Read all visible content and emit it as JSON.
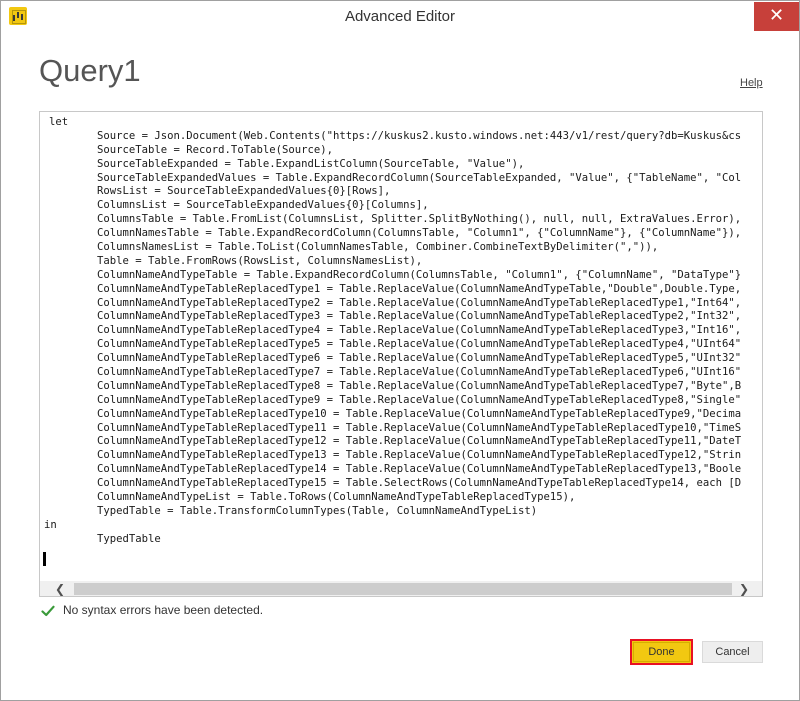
{
  "window": {
    "title": "Advanced Editor",
    "close_glyph": "✕"
  },
  "header": {
    "query_name": "Query1",
    "help_label": "Help"
  },
  "editor": {
    "lines": [
      {
        "indent": 0,
        "text": "let"
      },
      {
        "indent": 1,
        "text": "Source = Json.Document(Web.Contents(\"https://kuskus2.kusto.windows.net:443/v1/rest/query?db=Kuskus&cs"
      },
      {
        "indent": 1,
        "text": "SourceTable = Record.ToTable(Source),"
      },
      {
        "indent": 1,
        "text": "SourceTableExpanded = Table.ExpandListColumn(SourceTable, \"Value\"),"
      },
      {
        "indent": 1,
        "text": "SourceTableExpandedValues = Table.ExpandRecordColumn(SourceTableExpanded, \"Value\", {\"TableName\", \"Col"
      },
      {
        "indent": 1,
        "text": "RowsList = SourceTableExpandedValues{0}[Rows],"
      },
      {
        "indent": 1,
        "text": "ColumnsList = SourceTableExpandedValues{0}[Columns],"
      },
      {
        "indent": 1,
        "text": "ColumnsTable = Table.FromList(ColumnsList, Splitter.SplitByNothing(), null, null, ExtraValues.Error),"
      },
      {
        "indent": 1,
        "text": "ColumnNamesTable = Table.ExpandRecordColumn(ColumnsTable, \"Column1\", {\"ColumnName\"}, {\"ColumnName\"}),"
      },
      {
        "indent": 1,
        "text": "ColumnsNamesList = Table.ToList(ColumnNamesTable, Combiner.CombineTextByDelimiter(\",\")),"
      },
      {
        "indent": 1,
        "text": "Table = Table.FromRows(RowsList, ColumnsNamesList),"
      },
      {
        "indent": 1,
        "text": "ColumnNameAndTypeTable = Table.ExpandRecordColumn(ColumnsTable, \"Column1\", {\"ColumnName\", \"DataType\"}"
      },
      {
        "indent": 1,
        "text": "ColumnNameAndTypeTableReplacedType1 = Table.ReplaceValue(ColumnNameAndTypeTable,\"Double\",Double.Type,"
      },
      {
        "indent": 1,
        "text": "ColumnNameAndTypeTableReplacedType2 = Table.ReplaceValue(ColumnNameAndTypeTableReplacedType1,\"Int64\","
      },
      {
        "indent": 1,
        "text": "ColumnNameAndTypeTableReplacedType3 = Table.ReplaceValue(ColumnNameAndTypeTableReplacedType2,\"Int32\","
      },
      {
        "indent": 1,
        "text": "ColumnNameAndTypeTableReplacedType4 = Table.ReplaceValue(ColumnNameAndTypeTableReplacedType3,\"Int16\","
      },
      {
        "indent": 1,
        "text": "ColumnNameAndTypeTableReplacedType5 = Table.ReplaceValue(ColumnNameAndTypeTableReplacedType4,\"UInt64\""
      },
      {
        "indent": 1,
        "text": "ColumnNameAndTypeTableReplacedType6 = Table.ReplaceValue(ColumnNameAndTypeTableReplacedType5,\"UInt32\""
      },
      {
        "indent": 1,
        "text": "ColumnNameAndTypeTableReplacedType7 = Table.ReplaceValue(ColumnNameAndTypeTableReplacedType6,\"UInt16\""
      },
      {
        "indent": 1,
        "text": "ColumnNameAndTypeTableReplacedType8 = Table.ReplaceValue(ColumnNameAndTypeTableReplacedType7,\"Byte\",B"
      },
      {
        "indent": 1,
        "text": "ColumnNameAndTypeTableReplacedType9 = Table.ReplaceValue(ColumnNameAndTypeTableReplacedType8,\"Single\""
      },
      {
        "indent": 1,
        "text": "ColumnNameAndTypeTableReplacedType10 = Table.ReplaceValue(ColumnNameAndTypeTableReplacedType9,\"Decima"
      },
      {
        "indent": 1,
        "text": "ColumnNameAndTypeTableReplacedType11 = Table.ReplaceValue(ColumnNameAndTypeTableReplacedType10,\"TimeS"
      },
      {
        "indent": 1,
        "text": "ColumnNameAndTypeTableReplacedType12 = Table.ReplaceValue(ColumnNameAndTypeTableReplacedType11,\"DateT"
      },
      {
        "indent": 1,
        "text": "ColumnNameAndTypeTableReplacedType13 = Table.ReplaceValue(ColumnNameAndTypeTableReplacedType12,\"Strin"
      },
      {
        "indent": 1,
        "text": "ColumnNameAndTypeTableReplacedType14 = Table.ReplaceValue(ColumnNameAndTypeTableReplacedType13,\"Boole"
      },
      {
        "indent": 1,
        "text": "ColumnNameAndTypeTableReplacedType15 = Table.SelectRows(ColumnNameAndTypeTableReplacedType14, each [D"
      },
      {
        "indent": 1,
        "text": "ColumnNameAndTypeList = Table.ToRows(ColumnNameAndTypeTableReplacedType15),"
      },
      {
        "indent": 1,
        "text": "TypedTable = Table.TransformColumnTypes(Table, ColumnNameAndTypeList)"
      },
      {
        "indent": -1,
        "text": "in"
      },
      {
        "indent": 1,
        "text": "TypedTable"
      }
    ],
    "scroll_left_glyph": "❮",
    "scroll_right_glyph": "❯"
  },
  "status": {
    "icon": "check-icon",
    "message": "No syntax errors have been detected.",
    "color": "#3a9a3a"
  },
  "footer": {
    "done_label": "Done",
    "cancel_label": "Cancel"
  },
  "colors": {
    "accent": "#f2c811",
    "close": "#c7403a",
    "focus_outline": "#e81123"
  }
}
